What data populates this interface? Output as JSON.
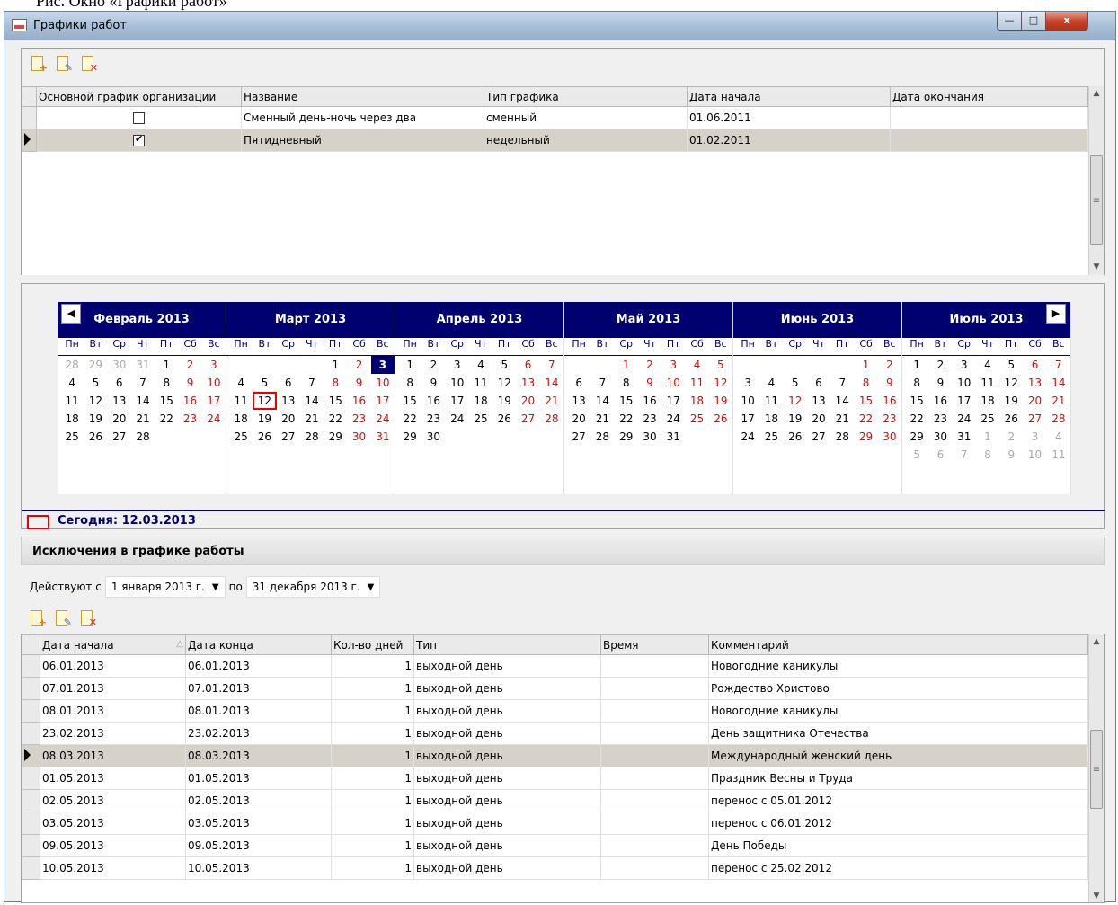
{
  "document_caption": "Рис. Окно «Графики работ»",
  "window": {
    "title": "Графики работ",
    "minimize": "—",
    "maximize": "□",
    "close": "x"
  },
  "schedules": {
    "columns": [
      "Основной график организации",
      "Название",
      "Тип графика",
      "Дата начала",
      "Дата окончания"
    ],
    "rows": [
      {
        "main": false,
        "name": "Сменный день-ночь через два",
        "type": "сменный",
        "start": "01.06.2011",
        "end": "",
        "selected": false
      },
      {
        "main": true,
        "name": "Пятидневный",
        "type": "недельный",
        "start": "01.02.2011",
        "end": "",
        "selected": true
      }
    ]
  },
  "calendar": {
    "dow": [
      "Пн",
      "Вт",
      "Ср",
      "Чт",
      "Пт",
      "Сб",
      "Вс"
    ],
    "months": [
      {
        "title": "Февраль 2013",
        "weeks": [
          [
            "28",
            "29",
            "30",
            "31",
            "1",
            "2",
            "3"
          ],
          [
            "4",
            "5",
            "6",
            "7",
            "8",
            "9",
            "10"
          ],
          [
            "11",
            "12",
            "13",
            "14",
            "15",
            "16",
            "17"
          ],
          [
            "18",
            "19",
            "20",
            "21",
            "22",
            "23",
            "24"
          ],
          [
            "25",
            "26",
            "27",
            "28",
            "",
            "",
            ""
          ]
        ]
      },
      {
        "title": "Март 2013",
        "weeks": [
          [
            "",
            "",
            "",
            "",
            "1",
            "2",
            "3"
          ],
          [
            "4",
            "5",
            "6",
            "7",
            "8",
            "9",
            "10"
          ],
          [
            "11",
            "12",
            "13",
            "14",
            "15",
            "16",
            "17"
          ],
          [
            "18",
            "19",
            "20",
            "21",
            "22",
            "23",
            "24"
          ],
          [
            "25",
            "26",
            "27",
            "28",
            "29",
            "30",
            "31"
          ]
        ]
      },
      {
        "title": "Апрель 2013",
        "weeks": [
          [
            "1",
            "2",
            "3",
            "4",
            "5",
            "6",
            "7"
          ],
          [
            "8",
            "9",
            "10",
            "11",
            "12",
            "13",
            "14"
          ],
          [
            "15",
            "16",
            "17",
            "18",
            "19",
            "20",
            "21"
          ],
          [
            "22",
            "23",
            "24",
            "25",
            "26",
            "27",
            "28"
          ],
          [
            "29",
            "30",
            "",
            "",
            "",
            "",
            ""
          ]
        ]
      },
      {
        "title": "Май 2013",
        "weeks": [
          [
            "",
            "",
            "1",
            "2",
            "3",
            "4",
            "5"
          ],
          [
            "6",
            "7",
            "8",
            "9",
            "10",
            "11",
            "12"
          ],
          [
            "13",
            "14",
            "15",
            "16",
            "17",
            "18",
            "19"
          ],
          [
            "20",
            "21",
            "22",
            "23",
            "24",
            "25",
            "26"
          ],
          [
            "27",
            "28",
            "29",
            "30",
            "31",
            "",
            ""
          ]
        ]
      },
      {
        "title": "Июнь 2013",
        "weeks": [
          [
            "",
            "",
            "",
            "",
            "",
            "1",
            "2"
          ],
          [
            "3",
            "4",
            "5",
            "6",
            "7",
            "8",
            "9"
          ],
          [
            "10",
            "11",
            "12",
            "13",
            "14",
            "15",
            "16"
          ],
          [
            "17",
            "18",
            "19",
            "20",
            "21",
            "22",
            "23"
          ],
          [
            "24",
            "25",
            "26",
            "27",
            "28",
            "29",
            "30"
          ]
        ]
      },
      {
        "title": "Июль 2013",
        "weeks": [
          [
            "1",
            "2",
            "3",
            "4",
            "5",
            "6",
            "7"
          ],
          [
            "8",
            "9",
            "10",
            "11",
            "12",
            "13",
            "14"
          ],
          [
            "15",
            "16",
            "17",
            "18",
            "19",
            "20",
            "21"
          ],
          [
            "22",
            "23",
            "24",
            "25",
            "26",
            "27",
            "28"
          ],
          [
            "29",
            "30",
            "31",
            "1",
            "2",
            "3",
            "4"
          ],
          [
            "5",
            "6",
            "7",
            "8",
            "9",
            "10",
            "11"
          ]
        ]
      }
    ],
    "today_label": "Сегодня: 12.03.2013",
    "colors": {
      "header": "#00006e",
      "holiday": "#e00000",
      "other_month": "#aaaaaa"
    }
  },
  "exceptions": {
    "title": "Исключения в графике работы",
    "period_label": "Действуют с",
    "from": "1 января  2013 г.",
    "to_label": "по",
    "to": "31 декабря  2013 г.",
    "columns": [
      "Дата начала",
      "Дата конца",
      "Кол-во дней",
      "Тип",
      "Время",
      "Комментарий"
    ],
    "rows": [
      {
        "start": "06.01.2013",
        "end": "06.01.2013",
        "days": "1",
        "type": "выходной день",
        "time": "",
        "comment": "Новогодние каникулы"
      },
      {
        "start": "07.01.2013",
        "end": "07.01.2013",
        "days": "1",
        "type": "выходной день",
        "time": "",
        "comment": "Рождество Христово"
      },
      {
        "start": "08.01.2013",
        "end": "08.01.2013",
        "days": "1",
        "type": "выходной день",
        "time": "",
        "comment": "Новогодние каникулы"
      },
      {
        "start": "23.02.2013",
        "end": "23.02.2013",
        "days": "1",
        "type": "выходной день",
        "time": "",
        "comment": "День защитника Отечества"
      },
      {
        "start": "08.03.2013",
        "end": "08.03.2013",
        "days": "1",
        "type": "выходной день",
        "time": "",
        "comment": "Международный женский день",
        "selected": true
      },
      {
        "start": "01.05.2013",
        "end": "01.05.2013",
        "days": "1",
        "type": "выходной день",
        "time": "",
        "comment": "Праздник Весны и Труда"
      },
      {
        "start": "02.05.2013",
        "end": "02.05.2013",
        "days": "1",
        "type": "выходной день",
        "time": "",
        "comment": "перенос с 05.01.2012"
      },
      {
        "start": "03.05.2013",
        "end": "03.05.2013",
        "days": "1",
        "type": "выходной день",
        "time": "",
        "comment": "перенос с 06.01.2012"
      },
      {
        "start": "09.05.2013",
        "end": "09.05.2013",
        "days": "1",
        "type": "выходной день",
        "time": "",
        "comment": "День Победы"
      },
      {
        "start": "10.05.2013",
        "end": "10.05.2013",
        "days": "1",
        "type": "выходной день",
        "time": "",
        "comment": "перенос с 25.02.2012"
      }
    ]
  }
}
